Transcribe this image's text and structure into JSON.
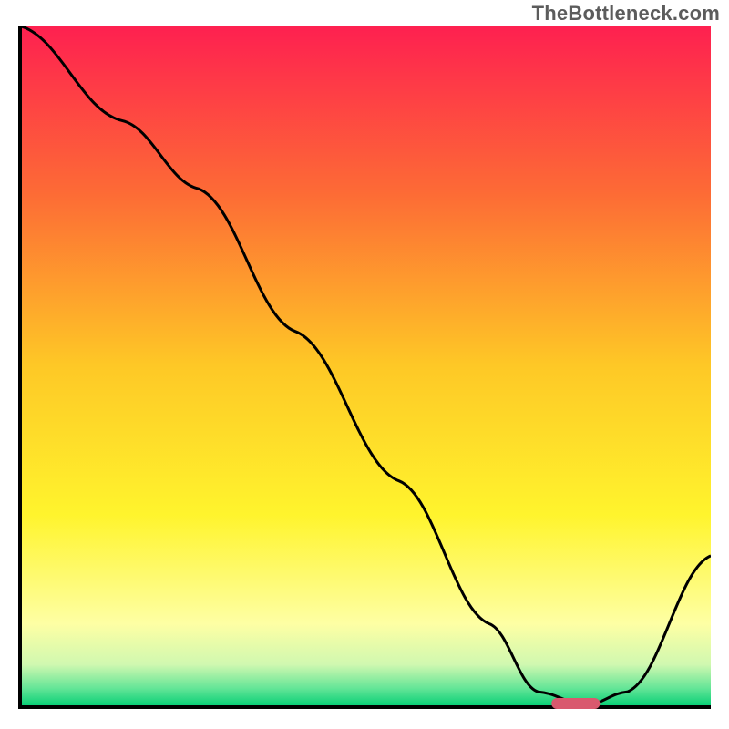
{
  "watermark": "TheBottleneck.com",
  "chart_data": {
    "type": "line",
    "title": "",
    "xlabel": "",
    "ylabel": "",
    "xlim": [
      0,
      100
    ],
    "ylim": [
      0,
      100
    ],
    "x": [
      0,
      15,
      26,
      40,
      55,
      68,
      75,
      82,
      88,
      100
    ],
    "values": [
      100,
      86,
      76,
      55,
      33,
      12,
      2,
      0,
      2,
      22
    ],
    "annotations": [
      {
        "type": "marker",
        "x_range": [
          77,
          84
        ],
        "y": 0,
        "color": "#d9596e"
      }
    ],
    "background_gradient": {
      "direction": "vertical",
      "stops": [
        {
          "offset": 0.0,
          "color": "#fe2050"
        },
        {
          "offset": 0.25,
          "color": "#fd6c35"
        },
        {
          "offset": 0.5,
          "color": "#fec826"
        },
        {
          "offset": 0.72,
          "color": "#fff42d"
        },
        {
          "offset": 0.88,
          "color": "#feffa4"
        },
        {
          "offset": 0.94,
          "color": "#d0f8b0"
        },
        {
          "offset": 0.975,
          "color": "#64e597"
        },
        {
          "offset": 1.0,
          "color": "#0bd077"
        }
      ]
    }
  }
}
